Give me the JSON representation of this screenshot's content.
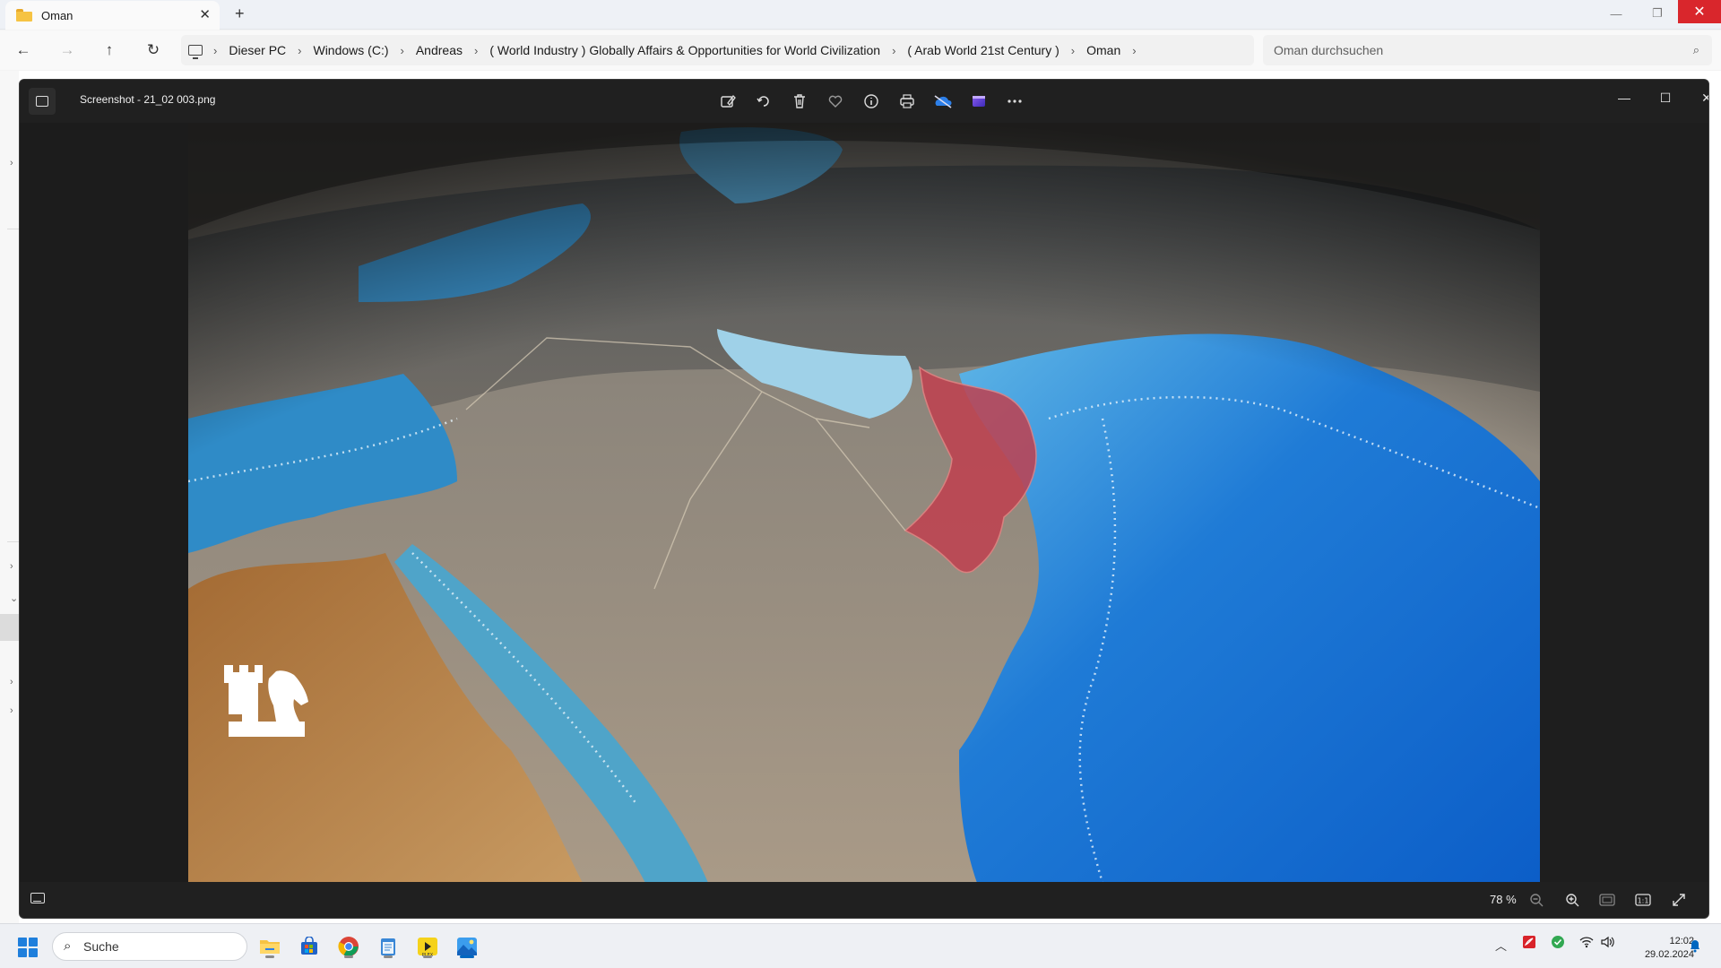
{
  "explorer": {
    "tab": {
      "title": "Oman"
    },
    "breadcrumb": [
      "Dieser PC",
      "Windows (C:)",
      "Andreas",
      "( World Industry ) Globally Affairs & Opportunities for World Civilization",
      "( Arab World 21st Century )",
      "Oman"
    ],
    "search_placeholder": "Oman durchsuchen"
  },
  "viewer": {
    "filename": "Screenshot - 21_02 003.png",
    "toolbar_icons": [
      "edit-image-icon",
      "rotate-icon",
      "delete-icon",
      "favorite-icon",
      "info-icon",
      "print-icon",
      "onedrive-icon",
      "clipchamp-icon",
      "more-icon"
    ],
    "zoom": "78 %",
    "image": {
      "description_icon": "rook-knight-logo-icon",
      "highlight_color": "#c0404f"
    }
  },
  "taskbar": {
    "search_label": "Suche",
    "time": "12:02",
    "date": "29.02.2024",
    "apps": [
      "file-explorer-icon",
      "microsoft-store-icon",
      "chrome-icon",
      "notepad-icon",
      "plex-icon",
      "photos-icon"
    ]
  },
  "colors": {
    "accent": "#0067c0",
    "close_red": "#d9262c"
  }
}
